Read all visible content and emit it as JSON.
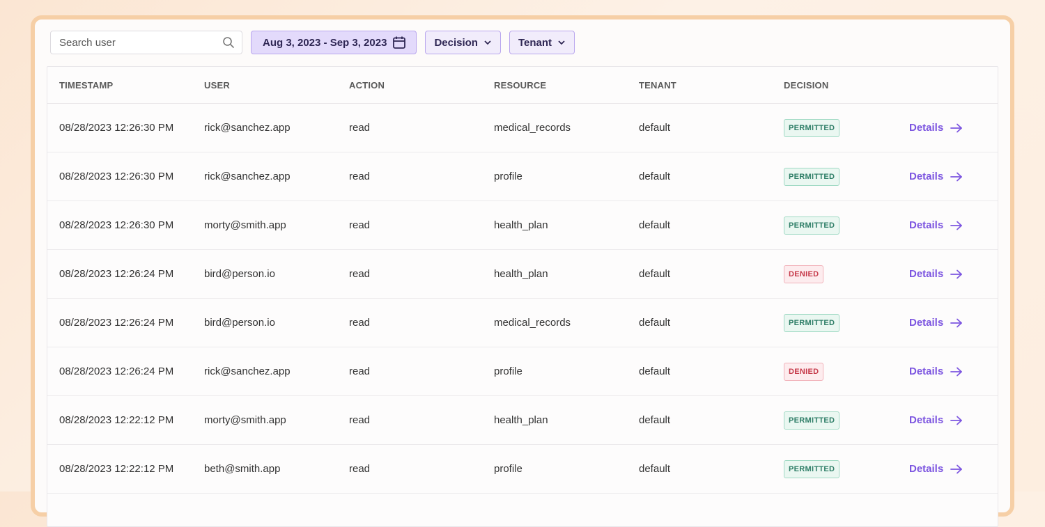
{
  "search": {
    "placeholder": "Search user",
    "icon": "search-icon"
  },
  "filters": {
    "date_range": "Aug 3, 2023 - Sep 3, 2023",
    "decision": "Decision",
    "tenant": "Tenant"
  },
  "table": {
    "headers": [
      "TIMESTAMP",
      "USER",
      "ACTION",
      "RESOURCE",
      "TENANT",
      "DECISION"
    ],
    "details_label": "Details",
    "rows": [
      {
        "timestamp": "08/28/2023 12:26:30 PM",
        "user": "rick@sanchez.app",
        "action": "read",
        "resource": "medical_records",
        "tenant": "default",
        "decision": "PERMITTED"
      },
      {
        "timestamp": "08/28/2023 12:26:30 PM",
        "user": "rick@sanchez.app",
        "action": "read",
        "resource": "profile",
        "tenant": "default",
        "decision": "PERMITTED"
      },
      {
        "timestamp": "08/28/2023 12:26:30 PM",
        "user": "morty@smith.app",
        "action": "read",
        "resource": "health_plan",
        "tenant": "default",
        "decision": "PERMITTED"
      },
      {
        "timestamp": "08/28/2023 12:26:24 PM",
        "user": "bird@person.io",
        "action": "read",
        "resource": "health_plan",
        "tenant": "default",
        "decision": "DENIED"
      },
      {
        "timestamp": "08/28/2023 12:26:24 PM",
        "user": "bird@person.io",
        "action": "read",
        "resource": "medical_records",
        "tenant": "default",
        "decision": "PERMITTED"
      },
      {
        "timestamp": "08/28/2023 12:26:24 PM",
        "user": "rick@sanchez.app",
        "action": "read",
        "resource": "profile",
        "tenant": "default",
        "decision": "DENIED"
      },
      {
        "timestamp": "08/28/2023 12:22:12 PM",
        "user": "morty@smith.app",
        "action": "read",
        "resource": "health_plan",
        "tenant": "default",
        "decision": "PERMITTED"
      },
      {
        "timestamp": "08/28/2023 12:22:12 PM",
        "user": "beth@smith.app",
        "action": "read",
        "resource": "profile",
        "tenant": "default",
        "decision": "PERMITTED"
      }
    ]
  },
  "colors": {
    "accent": "#7c55e0",
    "permitted": "#2d7d66",
    "denied": "#c63b4b",
    "frame_border": "#f6cfa6"
  }
}
